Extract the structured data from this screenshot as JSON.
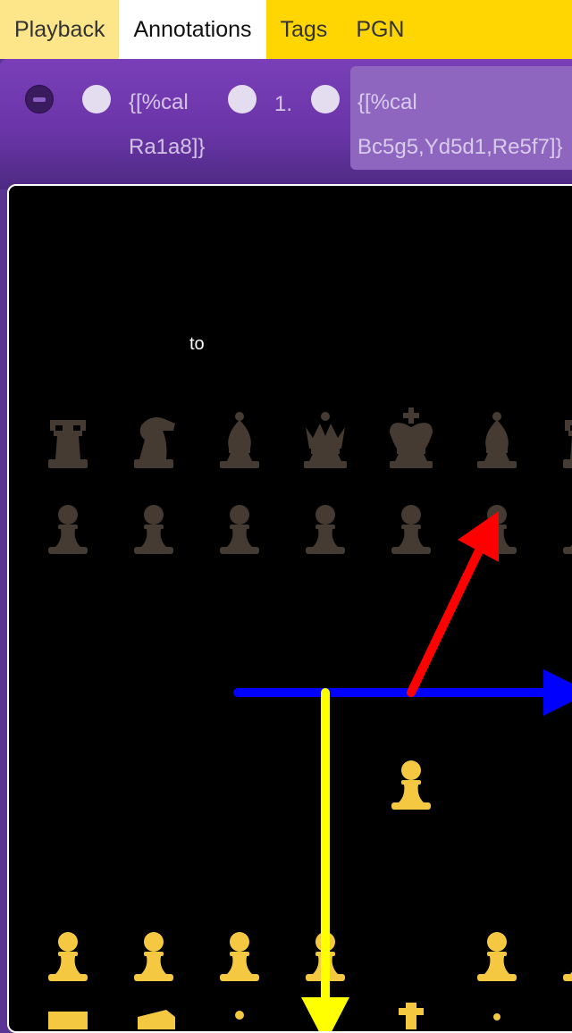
{
  "tabs": [
    {
      "label": "Playback"
    },
    {
      "label": "Annotations"
    },
    {
      "label": "Tags"
    },
    {
      "label": "PGN"
    }
  ],
  "active_tab": "Annotations",
  "moves": {
    "comment1_line1": "{[%cal",
    "comment1_line2": "Ra1a8]}",
    "move_number": "1.",
    "comment2_line1": "{[%cal",
    "comment2_line2": "Bc5g5,Yd5d1,Re5f7]}"
  },
  "board": {
    "label": "to",
    "black_back_rank": [
      "rook",
      "knight",
      "bishop",
      "queen",
      "king",
      "bishop",
      "rook"
    ],
    "black_pawns": 7,
    "white_center_pawn": "e4",
    "white_pawn_row": [
      "a2",
      "b2",
      "c2",
      "d2",
      "f2",
      "g2"
    ],
    "arrows": [
      {
        "color": "red",
        "from": "e5",
        "to": "f7"
      },
      {
        "color": "blue",
        "from": "c5",
        "to": "g5"
      },
      {
        "color": "yellow",
        "from": "d5",
        "to": "d1"
      }
    ]
  },
  "colors": {
    "tabbar": "#ffd602",
    "strip": "#6a35a8",
    "board_bg": "#000000",
    "white_piece": "#f5c842",
    "black_piece": "#4a3f36",
    "arrow_red": "#ff0000",
    "arrow_blue": "#0000ff",
    "arrow_yellow": "#ffff00"
  }
}
